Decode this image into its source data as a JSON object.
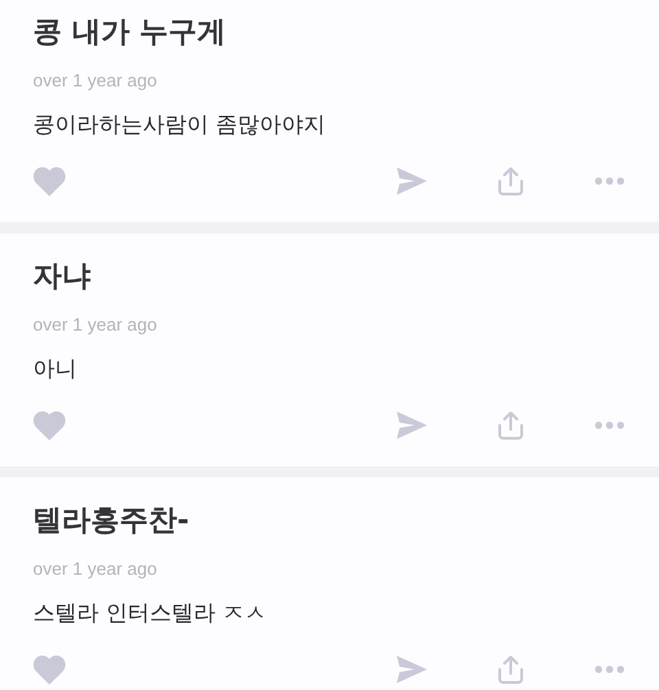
{
  "posts": [
    {
      "title": "콩 내가 누구게",
      "time": "over 1 year ago",
      "body": "콩이라하는사람이 좀많아야지"
    },
    {
      "title": "자냐",
      "time": "over 1 year ago",
      "body": "아니"
    },
    {
      "title": "텔라홍주찬-",
      "time": "over 1 year ago",
      "body": "스텔라 인터스텔라 ㅈㅅ"
    }
  ]
}
